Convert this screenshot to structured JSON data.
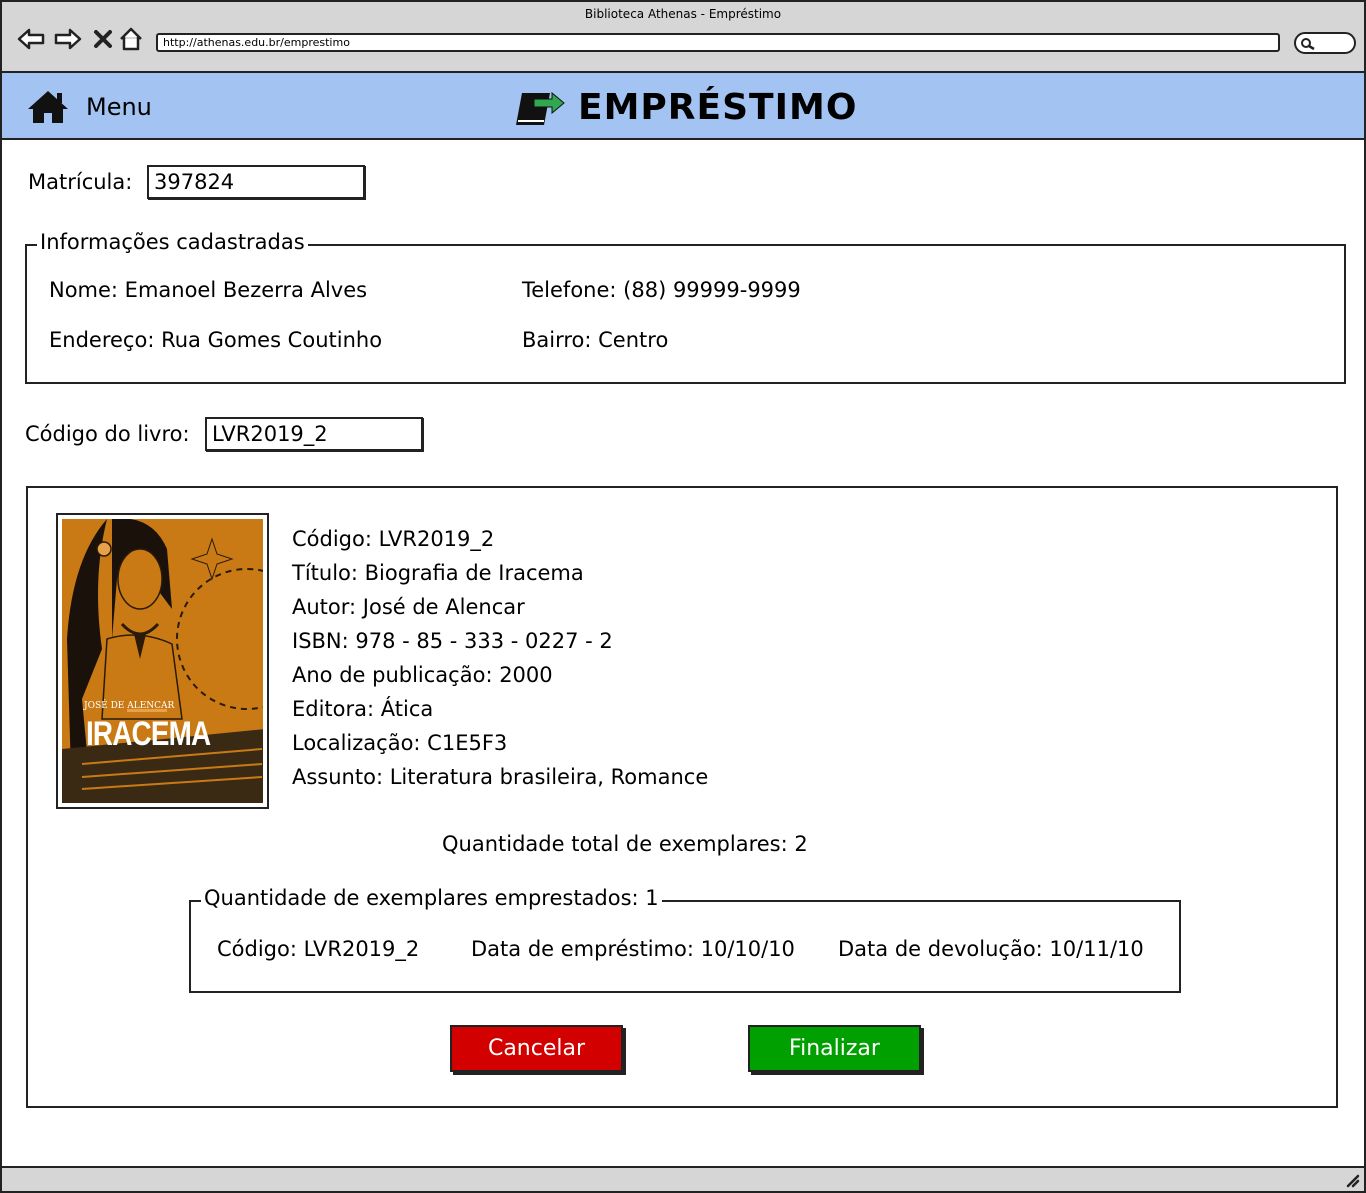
{
  "window": {
    "title": "Biblioteca Athenas - Empréstimo",
    "url": "http://athenas.edu.br/emprestimo"
  },
  "header": {
    "menu_label": "Menu",
    "page_title": "EMPRÉSTIMO",
    "background": "#a3c4f3"
  },
  "matricula": {
    "label": "Matrícula:",
    "value": "397824"
  },
  "registered_info": {
    "legend": "Informações cadastradas",
    "nome": "Nome: Emanoel Bezerra Alves",
    "telefone": "Telefone: (88) 99999-9999",
    "endereco": "Endereço: Rua Gomes Coutinho",
    "bairro": "Bairro: Centro"
  },
  "book_code": {
    "label": "Código do livro:",
    "value": "LVR2019_2"
  },
  "book": {
    "cover": {
      "author": "JOSÉ DE ALENCAR",
      "title": "IRACEMA",
      "color": "#c97a14"
    },
    "codigo": "Código: LVR2019_2",
    "titulo": "Título: Biografia de Iracema",
    "autor": "Autor: José de Alencar",
    "isbn": "ISBN: 978 - 85 - 333 - 0227 - 2",
    "ano": "Ano de publicação: 2000",
    "editora": "Editora: Ática",
    "localizacao": "Localização: C1E5F3",
    "assunto": "Assunto: Literatura brasileira, Romance"
  },
  "total_copies": "Quantidade total de exemplares: 2",
  "loans": {
    "legend": "Quantidade de exemplares emprestados: 1",
    "codigo": "Código: LVR2019_2",
    "data_emprestimo": "Data de empréstimo: 10/10/10",
    "data_devolucao": "Data de devolução: 10/11/10"
  },
  "buttons": {
    "cancel": "Cancelar",
    "finish": "Finalizar",
    "cancel_color": "#d30000",
    "finish_color": "#00a000"
  }
}
